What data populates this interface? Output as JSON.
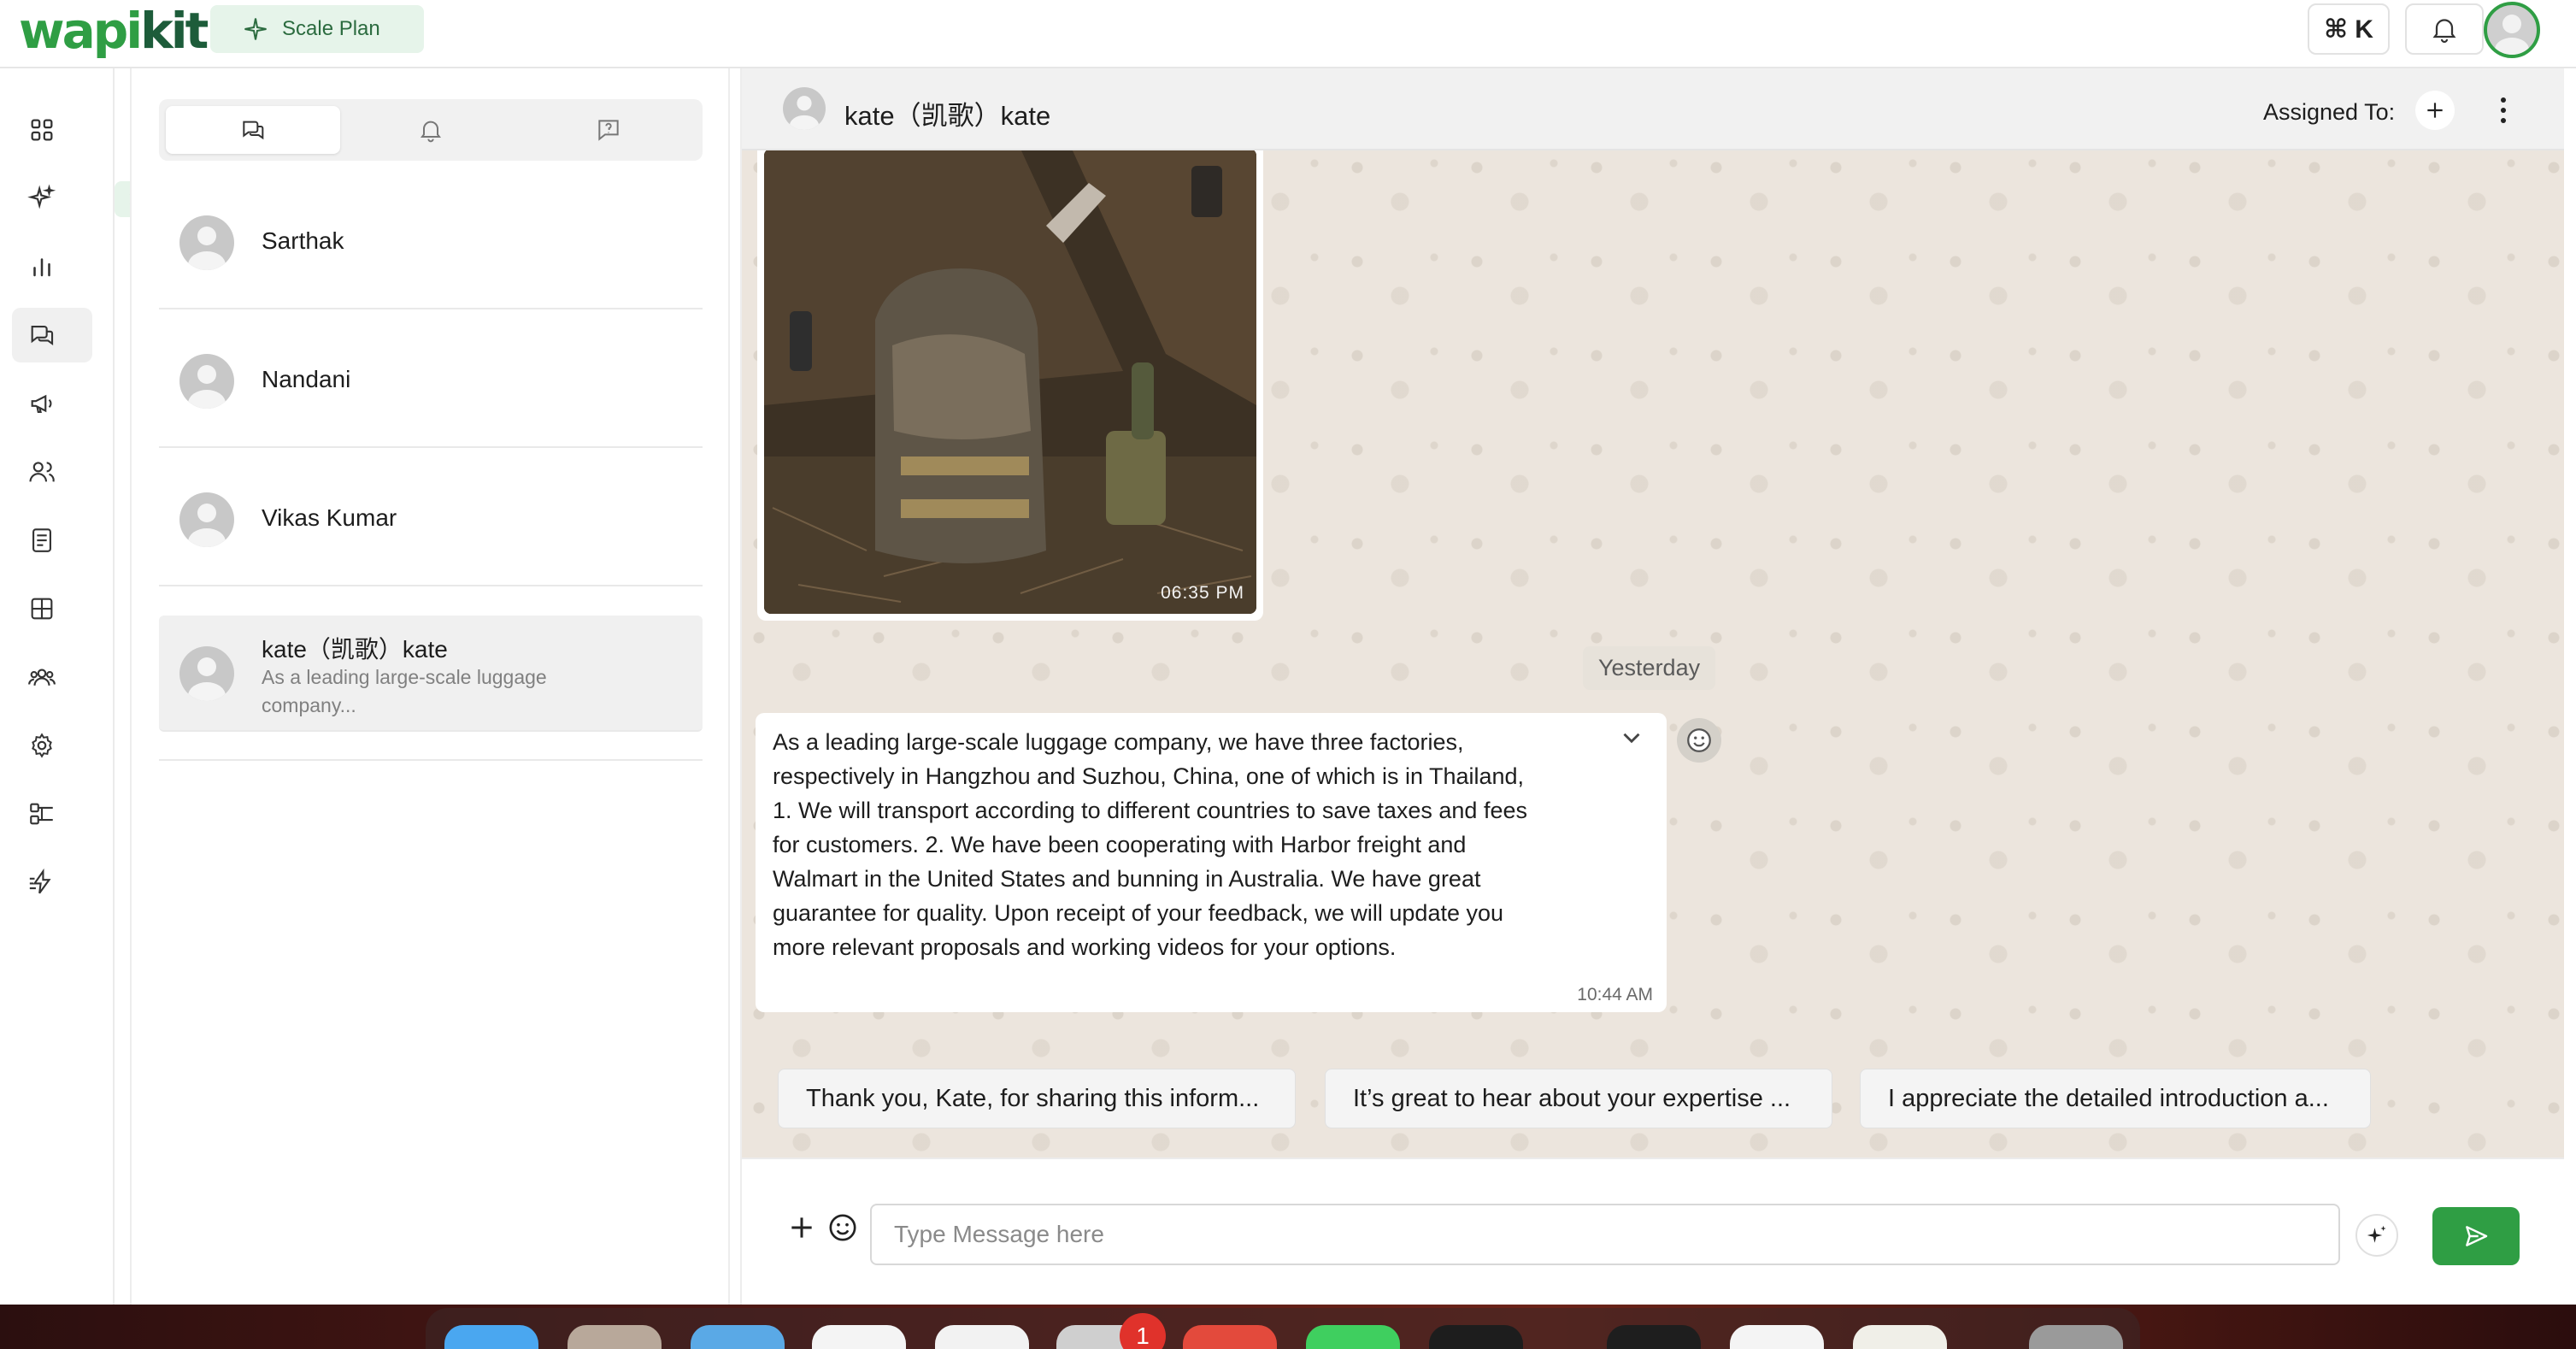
{
  "app": {
    "logo_text_a": "wapi",
    "logo_text_b": "kit",
    "plan_label": "Scale Plan",
    "shortcut_label": "⌘ K"
  },
  "nav": {
    "items": [
      "dashboard-icon",
      "ai-sparkle-icon",
      "analytics-icon",
      "chats-icon",
      "campaign-icon",
      "contacts-icon",
      "templates-icon",
      "widgets-icon",
      "team-icon",
      "settings-icon",
      "integrations-icon",
      "automation-icon"
    ],
    "active": "chats-icon"
  },
  "conversations": {
    "tabs": [
      "chats-tab-icon",
      "notifications-tab-icon",
      "unread-tab-icon"
    ],
    "items": [
      {
        "name": "Sarthak",
        "preview": ""
      },
      {
        "name": "Nandani",
        "preview": ""
      },
      {
        "name": "Vikas Kumar",
        "preview": ""
      },
      {
        "name": "kate（凯歌）kate",
        "preview": "As a leading large-scale luggage company..."
      }
    ]
  },
  "chat": {
    "contact_name": "kate（凯歌）kate",
    "assigned_label": "Assigned To:",
    "image_time": "06:35 PM",
    "day_separator": "Yesterday",
    "message_text": "As a leading large-scale luggage company, we have three factories, respectively in Hangzhou and Suzhou, China, one of which is in Thailand, 1. We will transport according to different countries to save taxes and fees for customers. 2. We have been cooperating with Harbor freight and Walmart in the United States and bunning in Australia. We have great guarantee for quality. Upon receipt of your feedback, we will update you more relevant proposals and working videos for your options.",
    "message_time": "10:44 AM",
    "suggestions": [
      "Thank you, Kate, for sharing this inform...",
      "It’s great to hear about your expertise ...",
      "I appreciate the detailed introduction a..."
    ],
    "composer_placeholder": "Type Message here"
  },
  "dock": {
    "badge_count": "1"
  },
  "colors": {
    "brand_green": "#2f9e44",
    "chat_bg": "#ece5dd"
  }
}
